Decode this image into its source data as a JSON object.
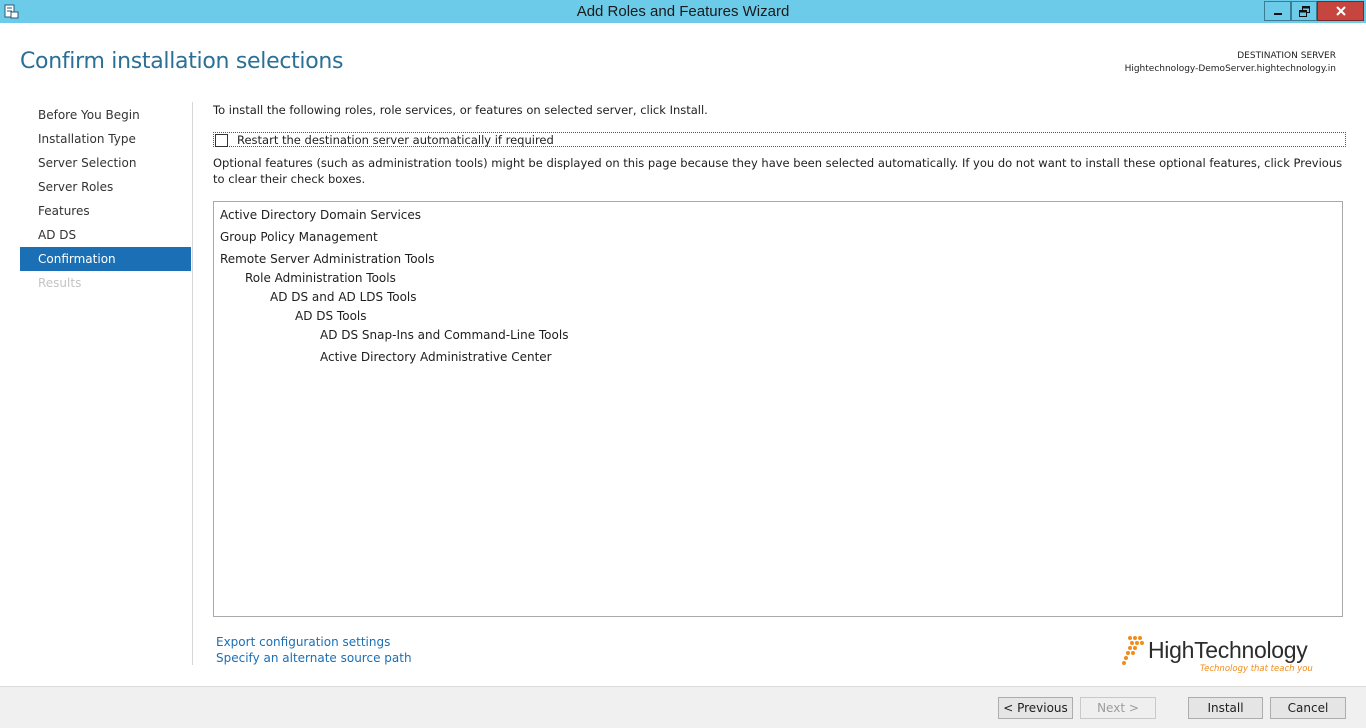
{
  "window": {
    "title": "Add Roles and Features Wizard"
  },
  "header": {
    "page_title": "Confirm installation selections",
    "destination_label": "DESTINATION SERVER",
    "destination_server": "Hightechnology-DemoServer.hightechnology.in"
  },
  "nav": {
    "items": [
      {
        "label": "Before You Begin",
        "state": "normal"
      },
      {
        "label": "Installation Type",
        "state": "normal"
      },
      {
        "label": "Server Selection",
        "state": "normal"
      },
      {
        "label": "Server Roles",
        "state": "normal"
      },
      {
        "label": "Features",
        "state": "normal"
      },
      {
        "label": "AD DS",
        "state": "normal"
      },
      {
        "label": "Confirmation",
        "state": "active"
      },
      {
        "label": "Results",
        "state": "disabled"
      }
    ]
  },
  "content": {
    "intro": "To install the following roles, role services, or features on selected server, click Install.",
    "restart_label": "Restart the destination server automatically if required",
    "restart_checked": false,
    "optional_note": "Optional features (such as administration tools) might be displayed on this page because they have been selected automatically. If you do not want to install these optional features, click Previous to clear their check boxes.",
    "features": [
      {
        "label": "Active Directory Domain Services",
        "level": 0
      },
      {
        "label": "Group Policy Management",
        "level": 0
      },
      {
        "label": "Remote Server Administration Tools",
        "level": 0
      },
      {
        "label": "Role Administration Tools",
        "level": 1
      },
      {
        "label": "AD DS and AD LDS Tools",
        "level": 2
      },
      {
        "label": "AD DS Tools",
        "level": 3
      },
      {
        "label": "AD DS Snap-Ins and Command-Line Tools",
        "level": 4
      },
      {
        "label": "Active Directory Administrative Center",
        "level": 4
      }
    ]
  },
  "links": {
    "export": "Export configuration settings",
    "alternate_source": "Specify an alternate source path"
  },
  "logo": {
    "name": "HighTechnology",
    "tagline": "Technology that teach you"
  },
  "footer": {
    "previous": "< Previous",
    "next": "Next >",
    "install": "Install",
    "cancel": "Cancel"
  },
  "colors": {
    "titlebar": "#6ccbe9",
    "accent": "#1a6fb5",
    "close_button": "#c7453f",
    "logo_orange": "#f28c1a"
  }
}
